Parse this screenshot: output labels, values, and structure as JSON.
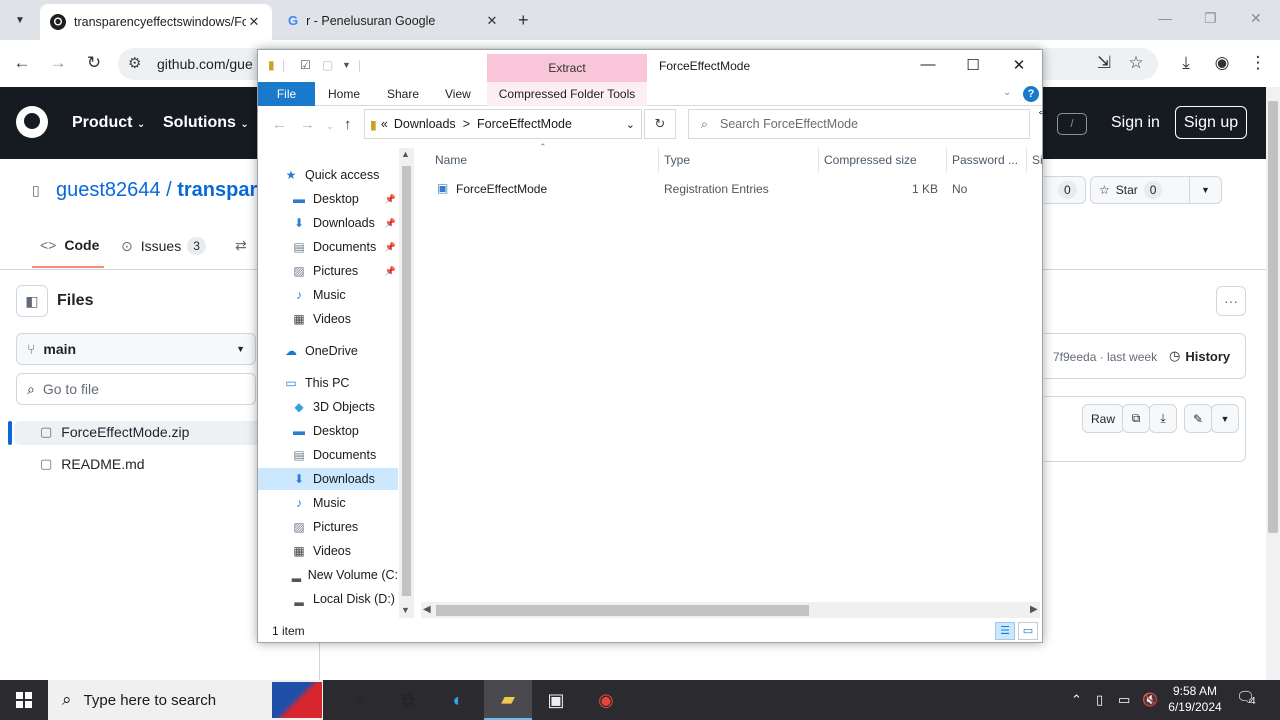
{
  "browser": {
    "tabs": [
      {
        "title": "transparencyeffectswindows/Fo",
        "icon": "github-icon"
      },
      {
        "title": "r - Penelusuran Google",
        "icon": "google-icon"
      }
    ],
    "url": "github.com/gue"
  },
  "github": {
    "nav": [
      "Product",
      "Solutions"
    ],
    "slash_key": "/",
    "sign_in": "Sign in",
    "sign_up": "Sign up",
    "repo_owner": "guest82644",
    "repo_sep": "/",
    "repo_name": "transpare",
    "watch_count": "0",
    "star_label": "Star",
    "star_count": "0",
    "tabs": [
      {
        "label": "Code"
      },
      {
        "label": "Issues",
        "count": "3"
      }
    ],
    "files_title": "Files",
    "branch": "main",
    "goto_placeholder": "Go to file",
    "tree": [
      "ForceEffectMode.zip",
      "README.md"
    ],
    "commit_text": "7f9eeda · last week",
    "history_label": "History",
    "raw_label": "Raw"
  },
  "explorer": {
    "extract_label": "Extract",
    "window_title": "ForceEffectMode",
    "ribbon": {
      "file": "File",
      "home": "Home",
      "share": "Share",
      "view": "View",
      "tools": "Compressed Folder Tools",
      "help": "?"
    },
    "address": {
      "prefix": "«",
      "crumb1": "Downloads",
      "sep": ">",
      "crumb2": "ForceEffectMode"
    },
    "search_placeholder": "Search ForceEffectMode",
    "nav": {
      "quick_access": "Quick access",
      "qa_items": [
        "Desktop",
        "Downloads",
        "Documents",
        "Pictures",
        "Music",
        "Videos"
      ],
      "onedrive": "OneDrive",
      "this_pc": "This PC",
      "pc_items": [
        "3D Objects",
        "Desktop",
        "Documents",
        "Downloads",
        "Music",
        "Pictures",
        "Videos",
        "New Volume (C:",
        "Local Disk (D:)"
      ]
    },
    "columns": {
      "name": "Name",
      "type": "Type",
      "compressed_size": "Compressed size",
      "password": "Password ...",
      "size_trunc": "Si"
    },
    "files": [
      {
        "name": "ForceEffectMode",
        "type": "Registration Entries",
        "compressed_size": "1 KB",
        "password": "No"
      }
    ],
    "status": "1 item"
  },
  "taskbar": {
    "search_placeholder": "Type here to search",
    "time": "9:58 AM",
    "date": "6/19/2024",
    "notification_count": "4"
  }
}
